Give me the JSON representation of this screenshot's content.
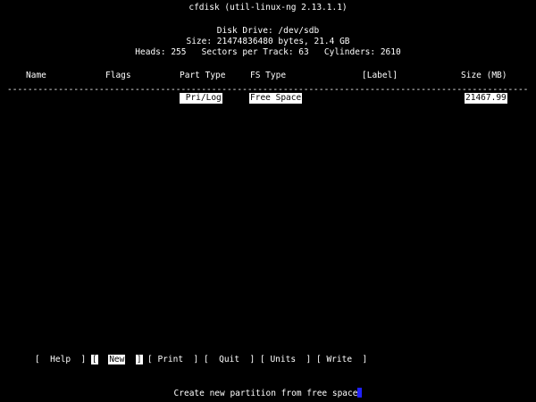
{
  "header": {
    "app_title": "cfdisk (util-linux-ng 2.13.1.1)",
    "disk_drive": "Disk Drive: /dev/sdb",
    "size_line": "Size: 21474836480 bytes, 21.4 GB",
    "geometry_line": "Heads: 255   Sectors per Track: 63   Cylinders: 2610"
  },
  "table": {
    "columns": {
      "name": "Name",
      "flags": "Flags",
      "part_type": "Part Type",
      "fs_type": "FS Type",
      "label": "[Label]",
      "size": "Size (MB)"
    },
    "divider": "--------------------------------------------------------------------------------------------------------------",
    "rows": [
      {
        "name": "",
        "flags": "",
        "part_type": "Pri/Log",
        "fs_type": "Free Space",
        "label": "",
        "size": "21467.99"
      }
    ]
  },
  "menu": {
    "help": "Help",
    "new": "New",
    "print": "Print",
    "quit": "Quit",
    "units": "Units",
    "write": "Write",
    "selected": "new"
  },
  "status": {
    "message": "Create new partition from free space"
  },
  "colors": {
    "background": "#000000",
    "foreground": "#ffffff",
    "cursor": "#2020ff"
  }
}
